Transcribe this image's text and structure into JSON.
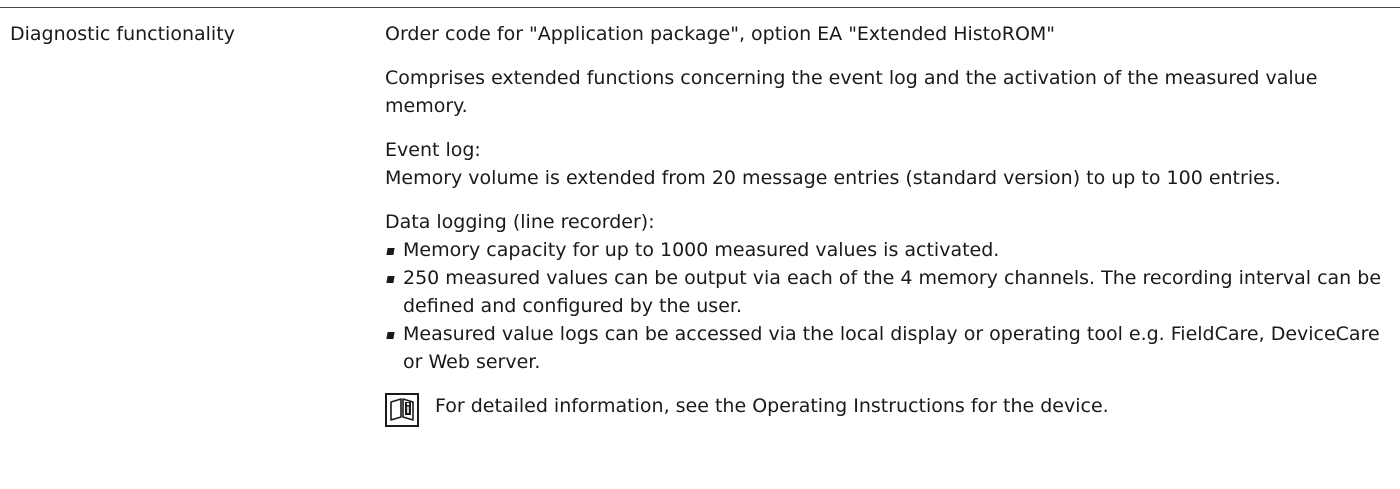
{
  "row": {
    "label": "Diagnostic functionality"
  },
  "content": {
    "order_code": "Order code for \"Application package\", option EA \"Extended HistoROM\"",
    "summary": "Comprises extended functions concerning the event log and the activation of the measured value memory.",
    "event_log": {
      "title": "Event log:",
      "text": "Memory volume is extended from 20 message entries (standard version) to up to 100 entries."
    },
    "data_logging": {
      "title": "Data logging (line recorder):",
      "items": [
        "Memory capacity for up to 1000 measured values is activated.",
        "250 measured values can be output via each of the 4 memory channels. The recording interval can be defined and configured by the user.",
        "Measured value logs can be accessed via the local display or operating tool e.g. FieldCare, DeviceCare or Web server."
      ]
    },
    "note": {
      "icon": "book-info-icon",
      "text": "For detailed information, see the Operating Instructions for the device."
    }
  }
}
